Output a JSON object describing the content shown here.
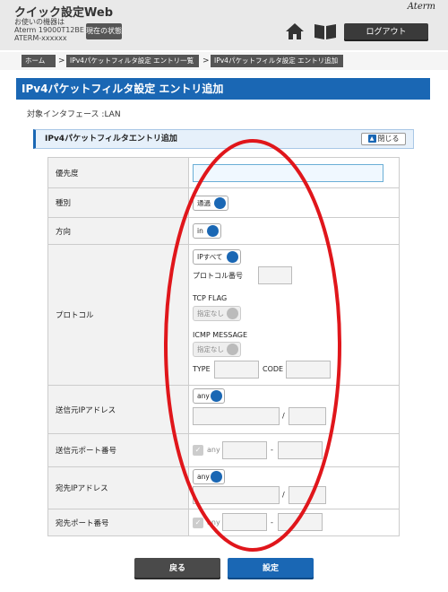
{
  "header": {
    "app_title": "クイック設定Web",
    "device_line1": "お使いの機器は",
    "device_line2": "Aterm 19000T12BE",
    "device_line3": "ATERM-xxxxxx",
    "status_button": "現在の状態",
    "brand": "Aterm",
    "home_icon": "home-icon",
    "manual_icon": "book-icon",
    "logout_button": "ログアウト"
  },
  "breadcrumb": [
    {
      "label": "ホーム"
    },
    {
      "label": "IPv4パケットフィルタ設定 エントリ一覧"
    },
    {
      "label": "IPv4パケットフィルタ設定 エントリ追加"
    }
  ],
  "page_title": "IPv4パケットフィルタ設定 エントリ追加",
  "interface_label": "対象インタフェース :LAN",
  "section": {
    "title": "IPv4パケットフィルタエントリ追加",
    "close_button": "閉じる"
  },
  "form": {
    "priority": {
      "label": "優先度",
      "value": ""
    },
    "type": {
      "label": "種別",
      "selected": "通過"
    },
    "direction": {
      "label": "方向",
      "selected": "in"
    },
    "protocol": {
      "label": "プロトコル",
      "selected": "IPすべて",
      "protocol_number_label": "プロトコル番号",
      "tcp_flag_label": "TCP FLAG",
      "tcp_flag_selected": "指定なし",
      "icmp_message_label": "ICMP MESSAGE",
      "icmp_message_selected": "指定なし",
      "type_label": "TYPE",
      "code_label": "CODE"
    },
    "src_ip": {
      "label": "送信元IPアドレス",
      "selected": "any",
      "slash": "/"
    },
    "src_port": {
      "label": "送信元ポート番号",
      "any_label": "any",
      "dash": "-",
      "checked": true
    },
    "dst_ip": {
      "label": "宛先IPアドレス",
      "selected": "any",
      "slash": "/"
    },
    "dst_port": {
      "label": "宛先ポート番号",
      "any_label": "any",
      "dash": "-",
      "checked": true
    }
  },
  "buttons": {
    "back": "戻る",
    "set": "設定"
  },
  "colors": {
    "accent": "#1a67b4",
    "annotation": "#e0161b"
  }
}
